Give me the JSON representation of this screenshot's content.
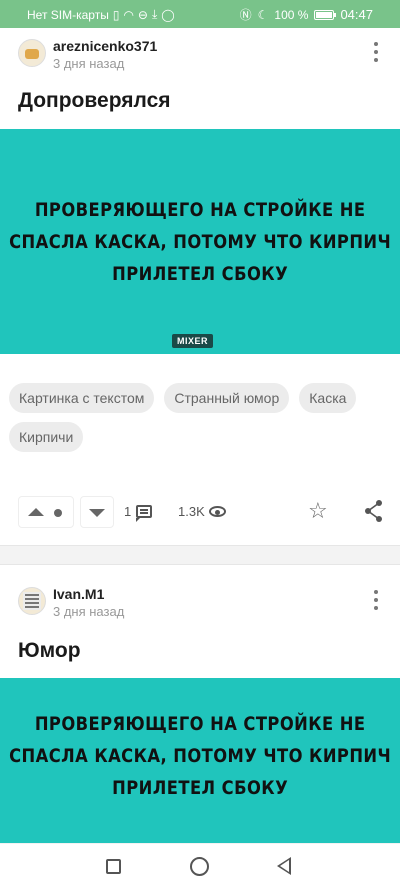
{
  "status_bar": {
    "carrier": "Нет SIM-карты",
    "battery": "100 %",
    "time": "04:47",
    "background": "#79c38a"
  },
  "posts": [
    {
      "author": "areznicenko371",
      "time": "3 дня назад",
      "title": "Допроверялся",
      "meme_lines": [
        "ПРОВЕРЯЮЩЕГО НА СТРОЙКЕ НЕ",
        "СПАСЛА КАСКА, ПОТОМУ ЧТО КИРПИЧ",
        "ПРИЛЕТЕЛ СБОКУ"
      ],
      "watermark": "MIXER",
      "meme_bg": "#20c5bc",
      "tags": [
        "Картинка с текстом",
        "Странный юмор",
        "Каска",
        "Кирпичи"
      ],
      "comments": "1",
      "views": "1.3K",
      "icons": [
        "more-vertical-icon",
        "arrow-up-icon",
        "arrow-down-icon",
        "comment-icon",
        "eye-icon",
        "star-icon",
        "share-icon"
      ]
    },
    {
      "author": "Ivan.M1",
      "time": "3 дня назад",
      "title": "Юмор",
      "meme_lines": [
        "ПРОВЕРЯЮЩЕГО НА СТРОЙКЕ НЕ",
        "СПАСЛА КАСКА, ПОТОМУ ЧТО КИРПИЧ",
        "ПРИЛЕТЕЛ СБОКУ"
      ]
    }
  ],
  "nav_bar": {
    "icons": [
      "recent-apps-icon",
      "home-icon",
      "back-icon"
    ]
  }
}
